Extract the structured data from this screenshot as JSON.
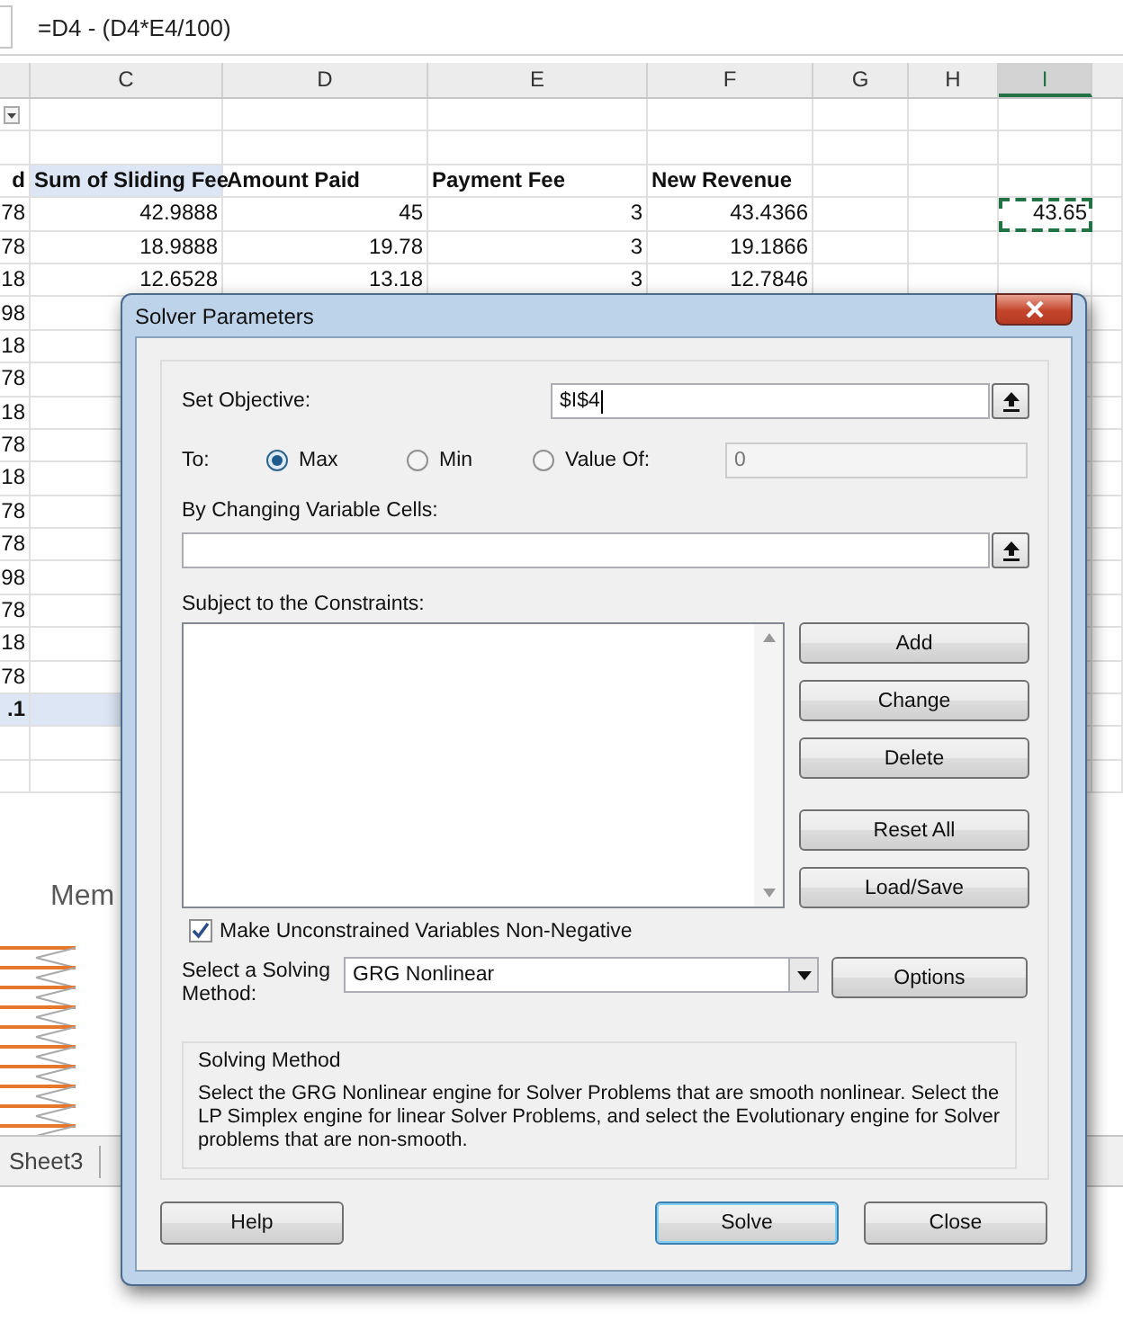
{
  "formula_bar": {
    "formula": "=D4 - (D4*E4/100)"
  },
  "columns": [
    {
      "label": "C",
      "selected": false
    },
    {
      "label": "D",
      "selected": false
    },
    {
      "label": "E",
      "selected": false
    },
    {
      "label": "F",
      "selected": false
    },
    {
      "label": "G",
      "selected": false
    },
    {
      "label": "H",
      "selected": false
    },
    {
      "label": "I",
      "selected": true
    }
  ],
  "rows": [
    {
      "kind": "filter",
      "cells": {}
    },
    {
      "kind": "blank",
      "cells": {}
    },
    {
      "kind": "header",
      "cells": {
        "a": "d",
        "c": "Sum of Sliding Fee",
        "d": "Amount Paid",
        "e": "Payment Fee",
        "f": "New Revenue"
      }
    },
    {
      "kind": "data",
      "copy_marquee": true,
      "cells": {
        "a": "78",
        "c": "42.9888",
        "d": "45",
        "e": "3",
        "f": "43.4366",
        "i": "43.65"
      }
    },
    {
      "kind": "data",
      "cells": {
        "a": "78",
        "c": "18.9888",
        "d": "19.78",
        "e": "3",
        "f": "19.1866"
      }
    },
    {
      "kind": "data",
      "cells": {
        "a": "18",
        "c": "12.6528",
        "d": "13.18",
        "e": "3",
        "f": "12.7846"
      }
    },
    {
      "kind": "data",
      "cells": {
        "a": "98"
      }
    },
    {
      "kind": "data",
      "cells": {
        "a": "18"
      }
    },
    {
      "kind": "data",
      "cells": {
        "a": "78"
      }
    },
    {
      "kind": "data",
      "cells": {
        "a": "18"
      }
    },
    {
      "kind": "data",
      "cells": {
        "a": "78"
      }
    },
    {
      "kind": "data",
      "cells": {
        "a": "18"
      }
    },
    {
      "kind": "data",
      "cells": {
        "a": "78"
      }
    },
    {
      "kind": "data",
      "cells": {
        "a": "78"
      }
    },
    {
      "kind": "data",
      "cells": {
        "a": "98"
      }
    },
    {
      "kind": "data",
      "cells": {
        "a": "78"
      }
    },
    {
      "kind": "data",
      "cells": {
        "a": "18"
      }
    },
    {
      "kind": "data",
      "cells": {
        "a": "78"
      }
    },
    {
      "kind": "total",
      "cells": {
        "a": ".1"
      }
    },
    {
      "kind": "blank",
      "cells": {}
    },
    {
      "kind": "blank",
      "cells": {}
    }
  ],
  "chart": {
    "title": "Mem"
  },
  "sheet_tabs": [
    {
      "label": "Sheet3",
      "selected": false
    }
  ],
  "dialog": {
    "title": "Solver Parameters",
    "objective": {
      "label": "Set Objective:",
      "value": "$I$4"
    },
    "to": {
      "label": "To:",
      "options": [
        {
          "label": "Max",
          "selected": true
        },
        {
          "label": "Min",
          "selected": false
        },
        {
          "label": "Value Of:",
          "selected": false
        }
      ],
      "value": "0",
      "disabled": true
    },
    "changing": {
      "label": "By Changing Variable Cells:"
    },
    "constraints": {
      "label": "Subject to the Constraints:",
      "button_groups": [
        [
          "Add",
          "Change",
          "Delete"
        ],
        [
          "Reset All",
          "Load/Save"
        ]
      ]
    },
    "nonnegative": {
      "label": "Make Unconstrained Variables Non-Negative",
      "checked": true
    },
    "method": {
      "label": "Select a Solving Method:",
      "value": "GRG Nonlinear",
      "button": "Options"
    },
    "group": {
      "title": "Solving Method",
      "text": "Select the GRG Nonlinear engine for Solver Problems that are smooth nonlinear. Select the LP Simplex engine for linear Solver Problems, and select the Evolutionary engine for Solver problems that are non-smooth."
    },
    "buttons": [
      {
        "label": "Help",
        "default": false
      },
      {
        "label": "Solve",
        "default": true
      },
      {
        "label": "Close",
        "default": false
      }
    ]
  }
}
